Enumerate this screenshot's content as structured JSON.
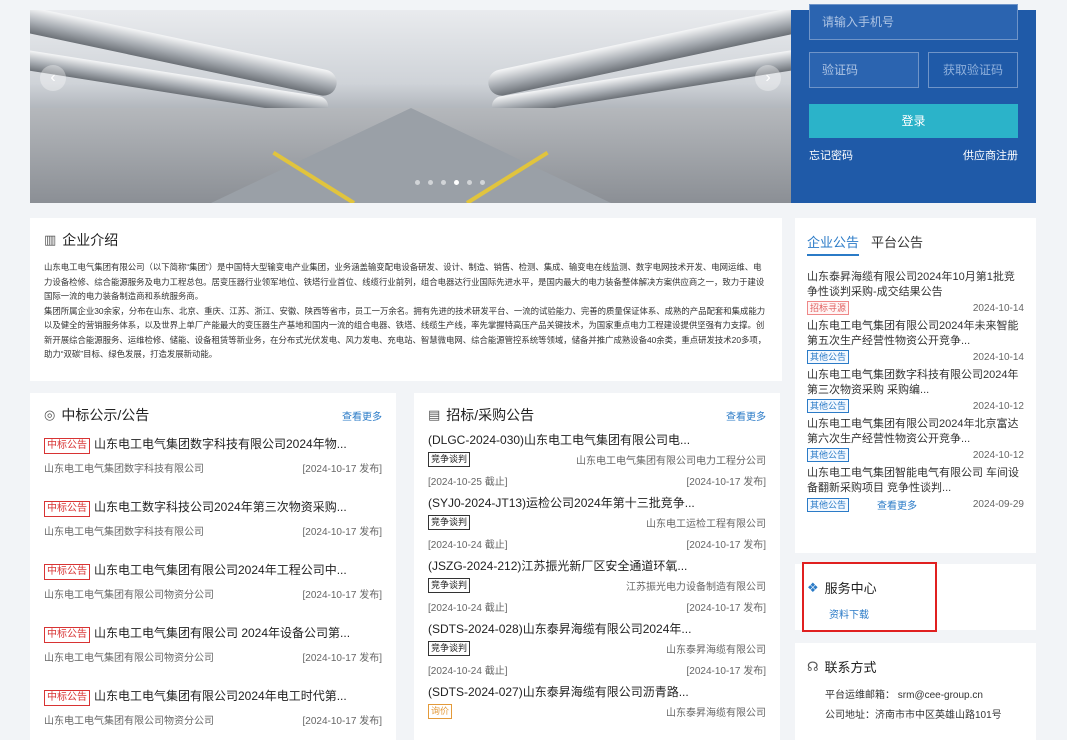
{
  "banner": {
    "slide_count": 6,
    "active_slide": 4
  },
  "login": {
    "phone_placeholder": "请输入手机号",
    "code_placeholder": "验证码",
    "get_code_label": "获取验证码",
    "login_label": "登录",
    "forgot_label": "忘记密码",
    "register_label": "供应商注册"
  },
  "intro": {
    "title": "企业介绍",
    "para1": "山东电工电气集团有限公司（以下简称“集团”）是中国特大型输变电产业集团，业务涵盖输变配电设备研发、设计、制造、销售、检测、集成、输变电在线监测、数字电网技术开发、电网运维、电力设备检修、综合能源服务及电力工程总包。居变压器行业领军地位、铁塔行业首位、线缆行业前列，组合电器达行业国际先进水平，是国内最大的电力装备整体解决方案供应商之一，致力于建设国际一流的电力装备制造商和系统服务商。",
    "para2": "集团所属企业30余家，分布在山东、北京、重庆、江苏、浙江、安徽、陕西等省市，员工一万余名。拥有先进的技术研发平台、一流的试验能力、完善的质量保证体系、成熟的产品配套和集成能力以及健全的营销服务体系，以及世界上单厂产能最大的变压器生产基地和国内一流的组合电器、铁塔、线缆生产线，率先掌握特高压产品关键技术，为国家重点电力工程建设提供坚强有力支撑。创新开展综合能源服务、运维检修、储能、设备租赁等新业务，在分布式光伏发电、风力发电、充电站、智慧微电网、综合能源管控系统等领域，储备并推广成熟设备40余类，重点研发技术20多项，助力“双碳”目标、绿色发展，打造发展新动能。"
  },
  "winning": {
    "title": "中标公示/公告",
    "more": "查看更多",
    "badge": "中标公告",
    "items": [
      {
        "title": "山东电工电气集团数字科技有限公司2024年物...",
        "org": "山东电工电气集团数字科技有限公司",
        "date": "[2024-10-17 发布]"
      },
      {
        "title": "山东电工数字科技公司2024年第三次物资采购...",
        "org": "山东电工电气集团数字科技有限公司",
        "date": "[2024-10-17 发布]"
      },
      {
        "title": "山东电工电气集团有限公司2024年工程公司中...",
        "org": "山东电工电气集团有限公司物资分公司",
        "date": "[2024-10-17 发布]"
      },
      {
        "title": "山东电工电气集团有限公司 2024年设备公司第...",
        "org": "山东电工电气集团有限公司物资分公司",
        "date": "[2024-10-17 发布]"
      },
      {
        "title": "山东电工电气集团有限公司2024年电工时代第...",
        "org": "山东电工电气集团有限公司物资分公司",
        "date": "[2024-10-17 发布]"
      }
    ]
  },
  "tender": {
    "title": "招标/采购公告",
    "more": "查看更多",
    "items": [
      {
        "title": "(DLGC-2024-030)山东电工电气集团有限公司电...",
        "badge": "竞争谈判",
        "org": "山东电工电气集团有限公司电力工程分公司",
        "deadline": "[2024-10-25 截止]",
        "date": "[2024-10-17 发布]"
      },
      {
        "title": "(SYJ0-2024-JT13)运检公司2024年第十三批竞争...",
        "badge": "竞争谈判",
        "org": "山东电工运检工程有限公司",
        "deadline": "[2024-10-24 截止]",
        "date": "[2024-10-17 发布]"
      },
      {
        "title": "(JSZG-2024-212)江苏振光新厂区安全通道环氧...",
        "badge": "竞争谈判",
        "org": "江苏振光电力设备制造有限公司",
        "deadline": "[2024-10-24 截止]",
        "date": "[2024-10-17 发布]"
      },
      {
        "title": "(SDTS-2024-028)山东泰昇海缆有限公司2024年...",
        "badge": "竞争谈判",
        "org": "山东泰昇海缆有限公司",
        "deadline": "[2024-10-24 截止]",
        "date": "[2024-10-17 发布]"
      },
      {
        "title": "(SDTS-2024-027)山东泰昇海缆有限公司沥青路...",
        "badge": "询价",
        "org": "山东泰昇海缆有限公司",
        "deadline": "",
        "date": ""
      }
    ]
  },
  "announcements": {
    "tabs": [
      "企业公告",
      "平台公告"
    ],
    "items": [
      {
        "title": "山东泰昇海缆有限公司2024年10月第1批竞争性谈判采购-成交结果公告",
        "badge": "招标寻源",
        "badge_type": "pink",
        "date": "2024-10-14"
      },
      {
        "title": "山东电工电气集团有限公司2024年未来智能第五次生产经营性物资公开竞争...",
        "badge": "其他公告",
        "badge_type": "blue",
        "date": "2024-10-14"
      },
      {
        "title": "山东电工电气集团数字科技有限公司2024年第三次物资采购 采购编...",
        "badge": "其他公告",
        "badge_type": "blue",
        "date": "2024-10-12"
      },
      {
        "title": "山东电工电气集团有限公司2024年北京富达第六次生产经营性物资公开竞争...",
        "badge": "其他公告",
        "badge_type": "blue",
        "date": "2024-10-12"
      },
      {
        "title": "山东电工电气集团智能电气有限公司 车间设备翻新采购项目 竞争性谈判...",
        "badge": "其他公告",
        "badge_type": "blue",
        "date": "2024-09-29"
      }
    ],
    "more": "查看更多"
  },
  "service": {
    "title": "服务中心",
    "link": "资料下载"
  },
  "contact": {
    "title": "联系方式",
    "email": "平台运维邮箱：  srm@cee-group.cn",
    "address": "公司地址：济南市市中区英雄山路101号"
  },
  "colors": {
    "brand_blue": "#1f5aa8",
    "login_button": "#2bb3c9",
    "link_blue": "#2b7bc7",
    "badge_red": "#d83333",
    "highlight_box": "#e02020"
  }
}
